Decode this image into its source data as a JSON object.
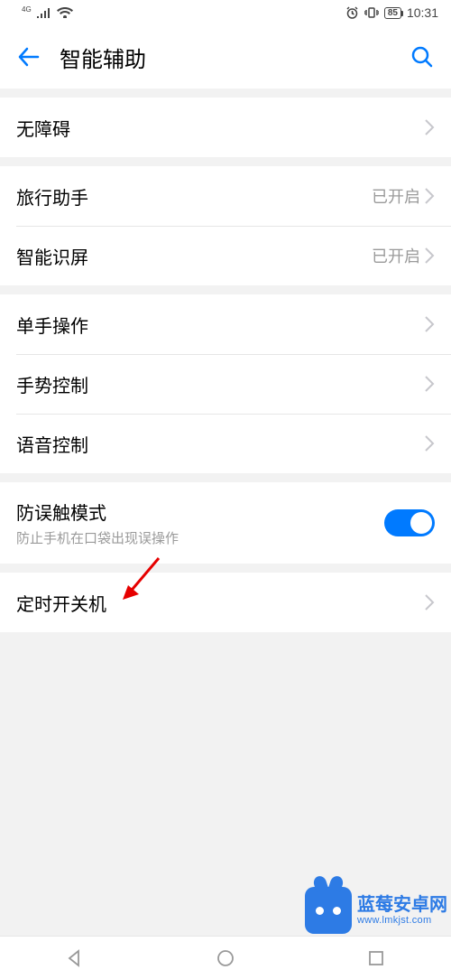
{
  "status": {
    "network": "4G",
    "battery": "85",
    "time": "10:31"
  },
  "header": {
    "title": "智能辅助"
  },
  "sections": [
    {
      "rows": [
        {
          "label": "无障碍",
          "value": ""
        }
      ]
    },
    {
      "rows": [
        {
          "label": "旅行助手",
          "value": "已开启"
        },
        {
          "label": "智能识屏",
          "value": "已开启"
        }
      ]
    },
    {
      "rows": [
        {
          "label": "单手操作",
          "value": ""
        },
        {
          "label": "手势控制",
          "value": ""
        },
        {
          "label": "语音控制",
          "value": ""
        }
      ]
    },
    {
      "rows": [
        {
          "label": "防误触模式",
          "subtitle": "防止手机在口袋出现误操作",
          "toggle": true
        }
      ]
    },
    {
      "rows": [
        {
          "label": "定时开关机",
          "value": ""
        }
      ]
    }
  ],
  "watermark": {
    "title": "蓝莓安卓网",
    "url": "www.lmkjst.com"
  }
}
